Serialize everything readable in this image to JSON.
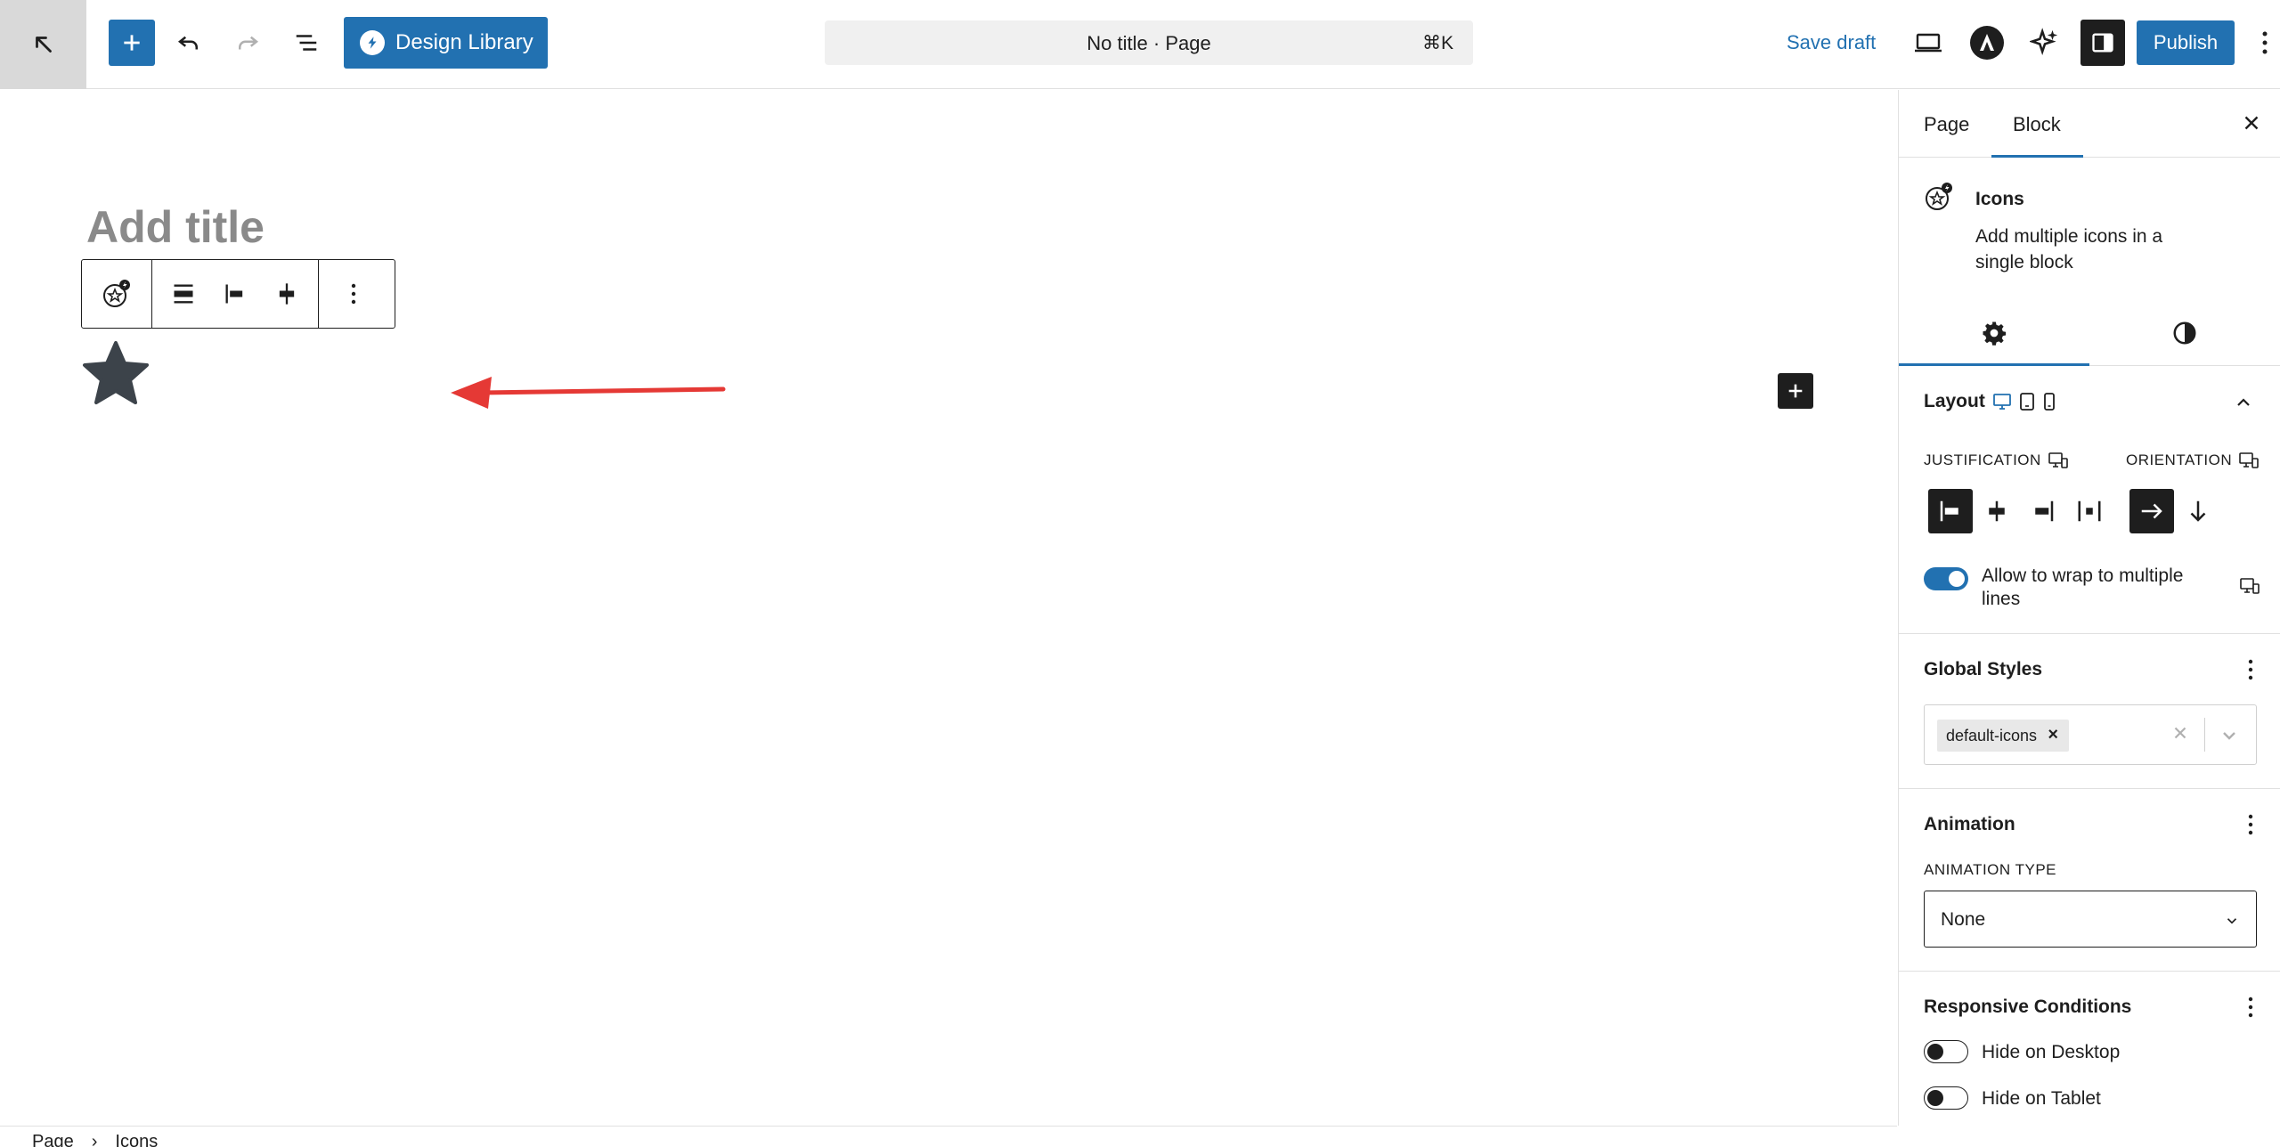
{
  "topbar": {
    "design_library_label": "Design Library",
    "document_title": "No title · Page",
    "command_shortcut": "⌘K",
    "save_draft_label": "Save draft",
    "publish_label": "Publish"
  },
  "canvas": {
    "title_placeholder": "Add title"
  },
  "breadcrumb": {
    "items": [
      "Page",
      "Icons"
    ]
  },
  "sidebar": {
    "tabs": [
      "Page",
      "Block"
    ],
    "active_tab": "Block",
    "block": {
      "name": "Icons",
      "description": "Add multiple icons in a single block"
    },
    "layout": {
      "title": "Layout",
      "justification_label": "Justification",
      "orientation_label": "Orientation",
      "wrap_label": "Allow to wrap to multiple lines",
      "wrap_enabled": true
    },
    "global_styles": {
      "title": "Global Styles",
      "selected_tag": "default-icons"
    },
    "animation": {
      "title": "Animation",
      "type_label": "Animation Type",
      "type_value": "None"
    },
    "responsive": {
      "title": "Responsive Conditions",
      "options": [
        {
          "label": "Hide on Desktop",
          "enabled": false
        },
        {
          "label": "Hide on Tablet",
          "enabled": false
        }
      ]
    }
  },
  "colors": {
    "accent": "#2271b1",
    "annotation_arrow": "#e53935",
    "dark": "#1e1e1e"
  }
}
